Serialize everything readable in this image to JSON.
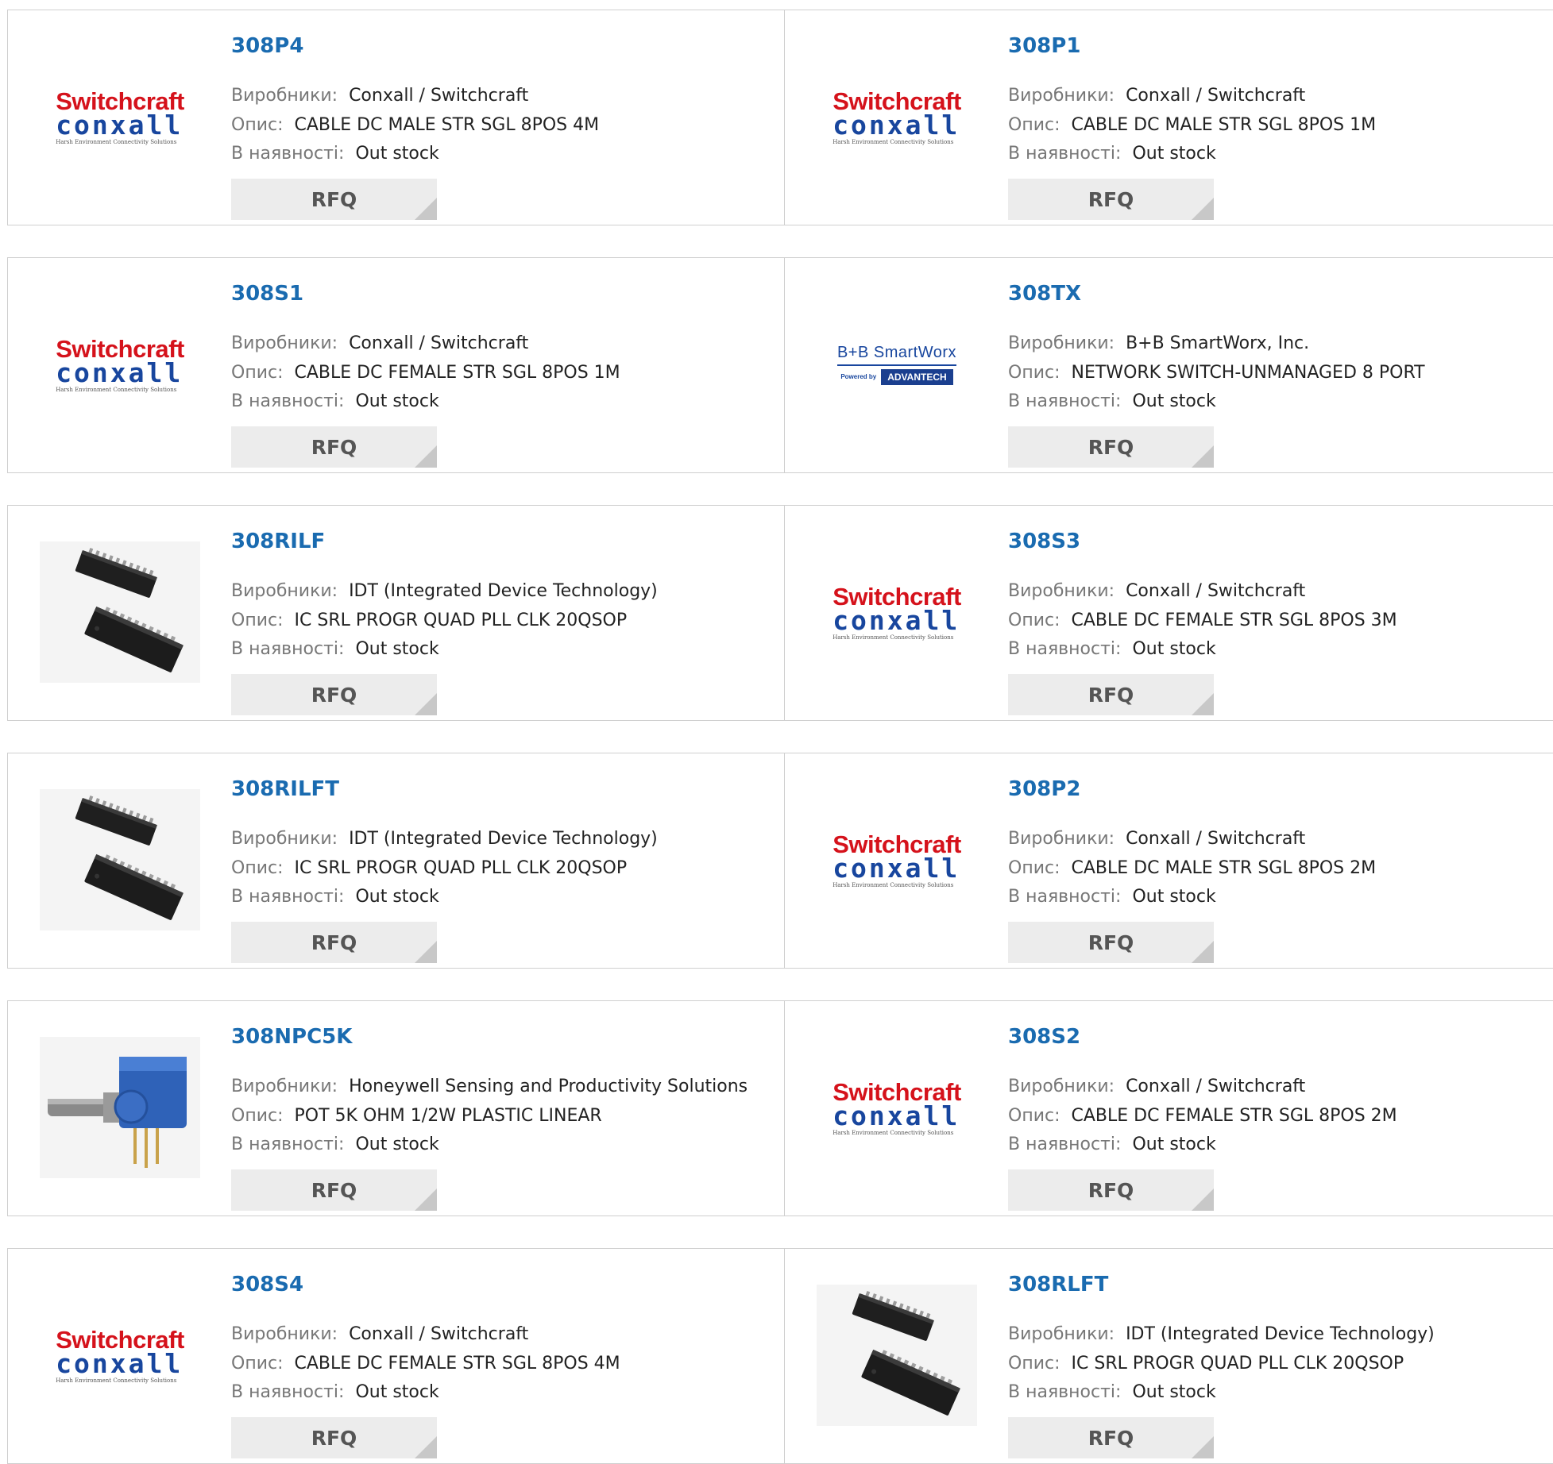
{
  "labels": {
    "manufacturer": "Виробники:",
    "description": "Опис:",
    "availability": "В наявності:",
    "rfq": "RFQ"
  },
  "logos": {
    "switchcraft_top": "Switchcraft",
    "switchcraft_bottom": "conxall",
    "switchcraft_tagline": "Harsh Environment Connectivity Solutions",
    "bb_top": "B+B SmartWorx",
    "bb_powered": "Powered by",
    "bb_advantech": "ADVANTECH"
  },
  "rows": [
    {
      "left": {
        "part": "308P4",
        "manufacturer": "Conxall / Switchcraft",
        "description": "CABLE DC MALE STR SGL 8POS 4M",
        "stock": "Out stock",
        "image": "switchcraft-logo"
      },
      "right": {
        "part": "308P1",
        "manufacturer": "Conxall / Switchcraft",
        "description": "CABLE DC MALE STR SGL 8POS 1M",
        "stock": "Out stock",
        "image": "switchcraft-logo"
      }
    },
    {
      "left": {
        "part": "308S1",
        "manufacturer": "Conxall / Switchcraft",
        "description": "CABLE DC FEMALE STR SGL 8POS 1M",
        "stock": "Out stock",
        "image": "switchcraft-logo"
      },
      "right": {
        "part": "308TX",
        "manufacturer": "B+B SmartWorx, Inc.",
        "description": "NETWORK SWITCH-UNMANAGED 8 PORT",
        "stock": "Out stock",
        "image": "bb-smartworx-logo"
      }
    },
    {
      "left": {
        "part": "308RILF",
        "manufacturer": "IDT (Integrated Device Technology)",
        "description": "IC SRL PROGR QUAD PLL CLK 20QSOP",
        "stock": "Out stock",
        "image": "ic-chip-photo"
      },
      "right": {
        "part": "308S3",
        "manufacturer": "Conxall / Switchcraft",
        "description": "CABLE DC FEMALE STR SGL 8POS 3M",
        "stock": "Out stock",
        "image": "switchcraft-logo"
      }
    },
    {
      "left": {
        "part": "308RILFT",
        "manufacturer": "IDT (Integrated Device Technology)",
        "description": "IC SRL PROGR QUAD PLL CLK 20QSOP",
        "stock": "Out stock",
        "image": "ic-chip-photo"
      },
      "right": {
        "part": "308P2",
        "manufacturer": "Conxall / Switchcraft",
        "description": "CABLE DC MALE STR SGL 8POS 2M",
        "stock": "Out stock",
        "image": "switchcraft-logo"
      }
    },
    {
      "left": {
        "part": "308NPC5K",
        "manufacturer": "Honeywell Sensing and Productivity Solutions",
        "description": "POT 5K OHM 1/2W PLASTIC LINEAR",
        "stock": "Out stock",
        "image": "potentiometer-photo"
      },
      "right": {
        "part": "308S2",
        "manufacturer": "Conxall / Switchcraft",
        "description": "CABLE DC FEMALE STR SGL 8POS 2M",
        "stock": "Out stock",
        "image": "switchcraft-logo"
      }
    },
    {
      "left": {
        "part": "308S4",
        "manufacturer": "Conxall / Switchcraft",
        "description": "CABLE DC FEMALE STR SGL 8POS 4M",
        "stock": "Out stock",
        "image": "switchcraft-logo"
      },
      "right": {
        "part": "308RLFT",
        "manufacturer": "IDT (Integrated Device Technology)",
        "description": "IC SRL PROGR QUAD PLL CLK 20QSOP",
        "stock": "Out stock",
        "image": "ic-chip-photo"
      }
    }
  ]
}
